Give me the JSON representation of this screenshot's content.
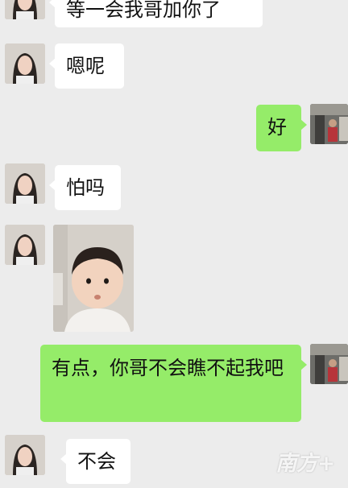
{
  "chat": {
    "messages": [
      {
        "sender": "contact",
        "text": "等一会我哥加你了"
      },
      {
        "sender": "contact",
        "text": "嗯呢"
      },
      {
        "sender": "me",
        "text": "好"
      },
      {
        "sender": "contact",
        "text": "怕吗"
      },
      {
        "sender": "contact",
        "type": "sticker"
      },
      {
        "sender": "me",
        "text": "有点，你哥不会瞧不起我吧"
      },
      {
        "sender": "contact",
        "text": "不会"
      }
    ]
  },
  "watermark": {
    "text": "南方+"
  },
  "colors": {
    "background": "#ececec",
    "incoming_bubble": "#ffffff",
    "outgoing_bubble": "#95ec69"
  }
}
